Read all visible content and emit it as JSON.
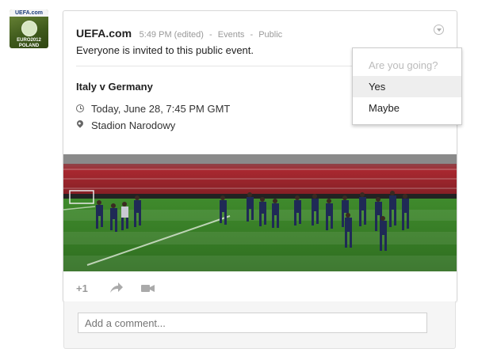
{
  "avatar": {
    "strip_text": "UEFA.com",
    "logo_text": "EURO2012 POLAND UKRAINE"
  },
  "post": {
    "author": "UEFA.com",
    "time": "5:49 PM (edited)",
    "category": "Events",
    "visibility": "Public",
    "separator": "-",
    "body": "Everyone is invited to this public event."
  },
  "event": {
    "title": "Italy v Germany",
    "datetime": "Today, June 28, 7:45 PM GMT",
    "location": "Stadion Narodowy"
  },
  "actions": {
    "plus_one": "+1"
  },
  "comment": {
    "placeholder": "Add a comment..."
  },
  "rsvp_menu": {
    "header": "Are you going?",
    "yes": "Yes",
    "maybe": "Maybe"
  },
  "colors": {
    "pitch": "#3c7d2a",
    "stands": "#b8262e",
    "menu_highlight": "#eeeeee"
  }
}
